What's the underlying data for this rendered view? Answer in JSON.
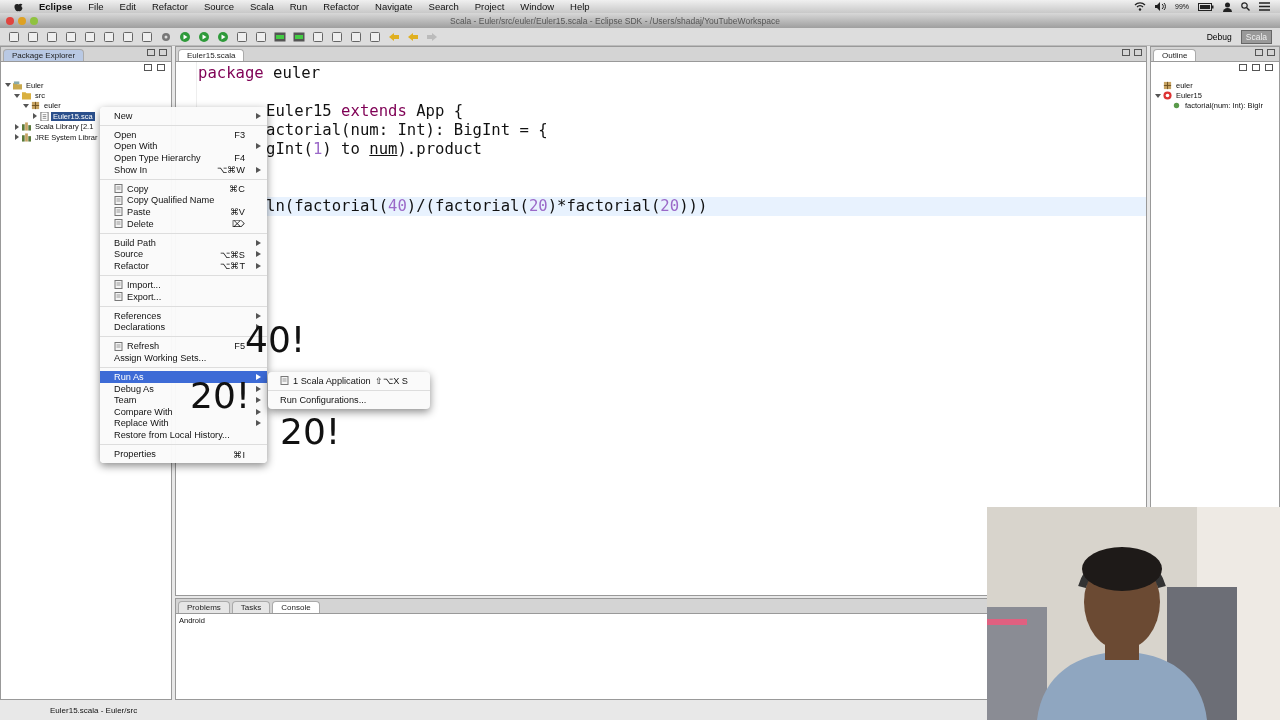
{
  "menubar": {
    "app": "Eclipse",
    "items": [
      "File",
      "Edit",
      "Refactor",
      "Source",
      "Scala",
      "Run",
      "Refactor",
      "Navigate",
      "Search",
      "Project",
      "Window",
      "Help"
    ],
    "battery": "99%"
  },
  "window": {
    "title": "Scala - Euler/src/euler/Euler15.scala - Eclipse SDK - /Users/shadaj/YouTubeWorkspace"
  },
  "perspectives": [
    {
      "label": "Debug",
      "selected": false
    },
    {
      "label": "Scala",
      "selected": true
    }
  ],
  "package_explorer": {
    "tab": {
      "label": "Package Explorer",
      "selected": true
    },
    "tree": [
      {
        "label": "Euler",
        "kind": "project",
        "expanded": true,
        "selected": false,
        "children": [
          {
            "label": "src",
            "kind": "folder",
            "expanded": true,
            "selected": false,
            "children": [
              {
                "label": "euler",
                "kind": "package",
                "expanded": true,
                "selected": false,
                "children": [
                  {
                    "label": "Euler15.sca",
                    "kind": "file",
                    "expanded": false,
                    "selected": true
                  }
                ]
              }
            ]
          },
          {
            "label": "Scala Library [2.1",
            "kind": "library",
            "expanded": false,
            "selected": false
          },
          {
            "label": "JRE System Librar",
            "kind": "library",
            "expanded": false,
            "selected": false
          }
        ]
      }
    ]
  },
  "editor": {
    "tabs": [
      {
        "label": "Euler15.scala",
        "selected": true
      }
    ],
    "lines": [
      {
        "kind": "full",
        "current": false,
        "tokens": [
          {
            "kind": "keyword",
            "text": "package"
          },
          {
            "kind": "plain",
            "text": " euler"
          }
        ]
      },
      {
        "kind": "blank"
      },
      {
        "kind": "partial",
        "current": false,
        "tokens": [
          {
            "kind": "plain",
            "text": "Euler15 "
          },
          {
            "kind": "keyword",
            "text": "extends"
          },
          {
            "kind": "plain",
            "text": " App {"
          }
        ]
      },
      {
        "kind": "partial",
        "current": false,
        "tokens": [
          {
            "kind": "plain",
            "text": "actorial(num: Int): BigInt = {"
          }
        ]
      },
      {
        "kind": "partial",
        "current": false,
        "tokens": [
          {
            "kind": "plain",
            "text": "gInt("
          },
          {
            "kind": "number",
            "text": "1"
          },
          {
            "kind": "plain",
            "text": ") to "
          },
          {
            "kind": "underline",
            "text": "num"
          },
          {
            "kind": "plain",
            "text": ").product"
          }
        ]
      },
      {
        "kind": "blank"
      },
      {
        "kind": "blank"
      },
      {
        "kind": "partial",
        "current": true,
        "tokens": [
          {
            "kind": "plain",
            "text": "ln(factorial("
          },
          {
            "kind": "number",
            "text": "40"
          },
          {
            "kind": "plain",
            "text": ")/(factorial("
          },
          {
            "kind": "number",
            "text": "20"
          },
          {
            "kind": "plain",
            "text": ")*factorial("
          },
          {
            "kind": "number",
            "text": "20"
          },
          {
            "kind": "plain",
            "text": ")))"
          }
        ]
      }
    ]
  },
  "outline": {
    "tab": {
      "label": "Outline",
      "selected": true
    },
    "tree": [
      {
        "label": "euler",
        "kind": "package"
      },
      {
        "label": "Euler15",
        "kind": "class",
        "expanded": true,
        "children": [
          {
            "label": "factorial(num: Int): BigIr",
            "kind": "method"
          }
        ]
      }
    ]
  },
  "bottom_panel": {
    "tabs": [
      {
        "label": "Problems",
        "selected": false
      },
      {
        "label": "Tasks",
        "selected": false
      },
      {
        "label": "Console",
        "selected": true
      }
    ],
    "console_text": "Android"
  },
  "context_menu": {
    "items": [
      {
        "kind": "item",
        "label": "New",
        "submenu": true,
        "selected": false
      },
      {
        "kind": "separator"
      },
      {
        "kind": "item",
        "label": "Open",
        "shortcut": "F3",
        "selected": false
      },
      {
        "kind": "item",
        "label": "Open With",
        "submenu": true,
        "selected": false
      },
      {
        "kind": "item",
        "label": "Open Type Hierarchy",
        "shortcut": "F4",
        "selected": false
      },
      {
        "kind": "item",
        "label": "Show In",
        "shortcut": "⌥⌘W",
        "submenu": true,
        "selected": false
      },
      {
        "kind": "separator"
      },
      {
        "kind": "icon-item",
        "label": "Copy",
        "shortcut": "⌘C",
        "selected": false
      },
      {
        "kind": "icon-item",
        "label": "Copy Qualified Name",
        "selected": false
      },
      {
        "kind": "icon-item",
        "label": "Paste",
        "shortcut": "⌘V",
        "selected": false
      },
      {
        "kind": "icon-item",
        "label": "Delete",
        "shortcut": "⌦",
        "selected": false
      },
      {
        "kind": "separator"
      },
      {
        "kind": "item",
        "label": "Build Path",
        "submenu": true,
        "selected": false
      },
      {
        "kind": "item",
        "label": "Source",
        "shortcut": "⌥⌘S",
        "submenu": true,
        "selected": false
      },
      {
        "kind": "item",
        "label": "Refactor",
        "shortcut": "⌥⌘T",
        "submenu": true,
        "selected": false
      },
      {
        "kind": "separator"
      },
      {
        "kind": "icon-item",
        "label": "Import...",
        "selected": false
      },
      {
        "kind": "icon-item",
        "label": "Export...",
        "selected": false
      },
      {
        "kind": "separator"
      },
      {
        "kind": "item",
        "label": "References",
        "submenu": true,
        "selected": false
      },
      {
        "kind": "item",
        "label": "Declarations",
        "submenu": true,
        "selected": false
      },
      {
        "kind": "separator"
      },
      {
        "kind": "icon-item",
        "label": "Refresh",
        "shortcut": "F5",
        "selected": false
      },
      {
        "kind": "item",
        "label": "Assign Working Sets...",
        "selected": false
      },
      {
        "kind": "separator"
      },
      {
        "kind": "item",
        "label": "Run As",
        "submenu": true,
        "selected": true
      },
      {
        "kind": "item",
        "label": "Debug As",
        "submenu": true,
        "selected": false
      },
      {
        "kind": "item",
        "label": "Team",
        "submenu": true,
        "selected": false
      },
      {
        "kind": "item",
        "label": "Compare With",
        "submenu": true,
        "selected": false
      },
      {
        "kind": "item",
        "label": "Replace With",
        "submenu": true,
        "selected": false
      },
      {
        "kind": "item",
        "label": "Restore from Local History...",
        "selected": false
      },
      {
        "kind": "separator"
      },
      {
        "kind": "item",
        "label": "Properties",
        "shortcut": "⌘I",
        "selected": false
      }
    ]
  },
  "submenu": {
    "items": [
      {
        "kind": "icon-item",
        "label": "1 Scala Application",
        "shortcut": "⇧⌥X S"
      },
      {
        "kind": "separator"
      },
      {
        "kind": "item",
        "label": "Run Configurations..."
      }
    ]
  },
  "annotations": [
    "40!",
    "20!",
    "20!"
  ],
  "status_bar": {
    "text": "Euler15.scala - Euler/src"
  }
}
